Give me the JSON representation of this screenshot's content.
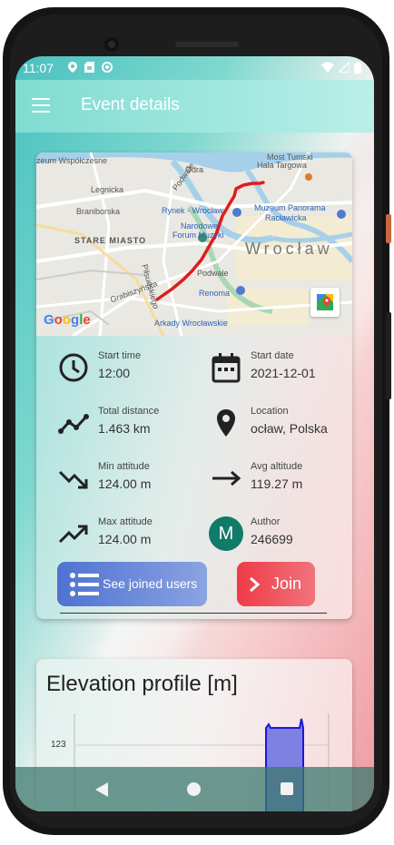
{
  "status": {
    "time": "11:07"
  },
  "appbar": {
    "title": "Event details"
  },
  "map": {
    "labels": {
      "muzeum_wspolczesne": "zeum Współczesne",
      "mostu_tumski": "Most Tumski",
      "hala_targowa": "Hala Targowa",
      "odra": "Odra",
      "legnicka": "Legnicka",
      "rynek": "Rynek - Wrocław",
      "muzeum_panorama_1": "Muzeum Panorama",
      "muzeum_panorama_2": "Racławicka",
      "braniborska": "Braniborska",
      "narodowe_1": "Narodowe",
      "narodowe_2": "Forum Muzyki",
      "stare_miasto": "STARE MIASTO",
      "wroclaw": "Wrocław",
      "pilsudskiego": "Piłsudskiego",
      "podwale": "Podwale",
      "renoma": "Renoma",
      "grabiszynska": "Grabiszyńska",
      "arkady": "Arkady Wrocławskie",
      "podwale2": "Podwale",
      "google": "Google"
    }
  },
  "details": {
    "start_time": {
      "label": "Start time",
      "value": "12:00"
    },
    "start_date": {
      "label": "Start date",
      "value": "2021-12-01"
    },
    "total_distance": {
      "label": "Total distance",
      "value": "1.463 km"
    },
    "location": {
      "label": "Location",
      "value": "ocław, Polska"
    },
    "min_altitude": {
      "label": "Min attitude",
      "value": "124.00 m"
    },
    "avg_altitude": {
      "label": "Avg altitude",
      "value": "119.27 m"
    },
    "max_altitude": {
      "label": "Max attitude",
      "value": "124.00 m"
    },
    "author": {
      "label": "Author",
      "value": "246699",
      "initial": "M"
    }
  },
  "buttons": {
    "see_joined_users": "See joined users",
    "join": "Join"
  },
  "elevation": {
    "title": "Elevation profile [m]",
    "chart_data": {
      "type": "area",
      "y_tick": "123"
    }
  },
  "colors": {
    "accent_teal": "#7fdcd1",
    "join_red": "#ee3b48",
    "users_blue": "#4f72d1",
    "author_green": "#0f7b68",
    "route_red": "#e01b1b"
  }
}
